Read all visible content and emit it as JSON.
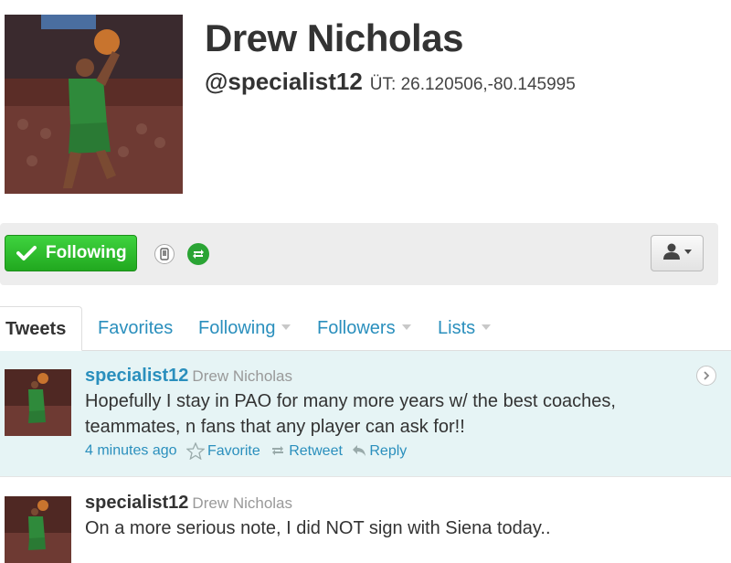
{
  "profile": {
    "name": "Drew Nicholas",
    "handle": "@specialist12",
    "location": "ÜT: 26.120506,-80.145995",
    "avatar_alt": "player-photo"
  },
  "actions": {
    "following_label": "Following",
    "follow_icon": "checkmark-icon",
    "device_icon": "phone-notifications-icon",
    "retweet_icon": "retweet-icon",
    "user_menu_icon": "person-dropdown-icon"
  },
  "tabs": [
    {
      "label": "Tweets",
      "active": true
    },
    {
      "label": "Favorites",
      "active": false
    },
    {
      "label": "Following",
      "active": false
    },
    {
      "label": "Followers",
      "active": false
    },
    {
      "label": "Lists",
      "active": false
    }
  ],
  "tweets": [
    {
      "username": "specialist12",
      "fullname": "Drew Nicholas",
      "text": "Hopefully I stay in PAO for many more years w/ the best coaches, teammates, n fans that any player can ask for!!",
      "time": "4 minutes ago",
      "favorite_label": "Favorite",
      "retweet_label": "Retweet",
      "reply_label": "Reply"
    },
    {
      "username": "specialist12",
      "fullname": "Drew Nicholas",
      "text": "On a more serious note, I did NOT sign with Siena today.."
    }
  ],
  "colors": {
    "link": "#2a8fbd",
    "follow_green": "#2bb92a",
    "highlight_bg": "#e6f4f5",
    "action_bar_bg": "#ededed"
  }
}
